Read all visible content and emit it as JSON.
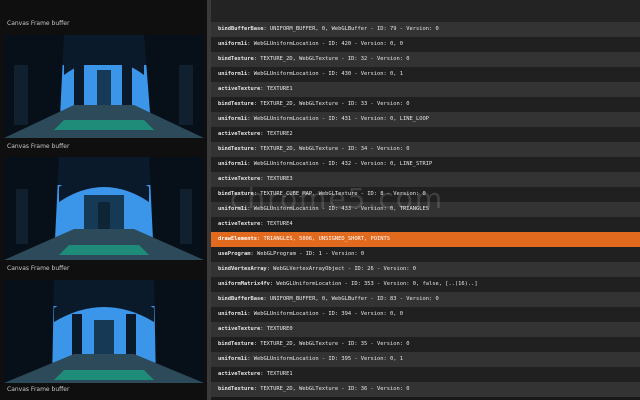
{
  "frames": [
    {
      "label": "Canvas Frame buffer"
    },
    {
      "label": "Canvas Frame buffer"
    },
    {
      "label": "Canvas Frame buffer"
    },
    {
      "label": "Canvas Frame buffer"
    }
  ],
  "commands": [
    {
      "name": "bindBufferBase",
      "args": ": UNIFORM_BUFFER, 0, WebGLBuffer - ID: 79 - Version: 0"
    },
    {
      "name": "uniform1i",
      "args": ": WebGLUniformLocation - ID: 420 - Version: 0, 0"
    },
    {
      "name": "bindTexture",
      "args": ": TEXTURE_2D, WebGLTexture - ID: 32 - Version: 0"
    },
    {
      "name": "uniform1i",
      "args": ": WebGLUniformLocation - ID: 430 - Version: 0, 1"
    },
    {
      "name": "activeTexture",
      "args": ": TEXTURE1"
    },
    {
      "name": "bindTexture",
      "args": ": TEXTURE_2D, WebGLTexture - ID: 33 - Version: 0"
    },
    {
      "name": "uniform1i",
      "args": ": WebGLUniformLocation - ID: 431 - Version: 0, LINE_LOOP"
    },
    {
      "name": "activeTexture",
      "args": ": TEXTURE2"
    },
    {
      "name": "bindTexture",
      "args": ": TEXTURE_2D, WebGLTexture - ID: 34 - Version: 0"
    },
    {
      "name": "uniform1i",
      "args": ": WebGLUniformLocation - ID: 432 - Version: 0, LINE_STRIP"
    },
    {
      "name": "activeTexture",
      "args": ": TEXTURE3"
    },
    {
      "name": "bindTexture",
      "args": ": TEXTURE_CUBE_MAP, WebGLTexture - ID: 8 - Version: 0"
    },
    {
      "name": "uniform1i",
      "args": ": WebGLUniformLocation - ID: 433 - Version: 0, TRIANGLES"
    },
    {
      "name": "activeTexture",
      "args": ": TEXTURE4"
    },
    {
      "name": "drawElements",
      "args": ": TRIANGLES, 5006, UNSIGNED_SHORT, POINTS",
      "highlight": true
    },
    {
      "name": "useProgram",
      "args": ": WebGLProgram - ID: 1 - Version: 0"
    },
    {
      "name": "bindVertexArray",
      "args": ": WebGLVertexArrayObject - ID: 26 - Version: 0"
    },
    {
      "name": "uniformMatrix4fv",
      "args": ": WebGLUniformLocation - ID: 353 - Version: 0, false, [..(16)..]"
    },
    {
      "name": "bindBufferBase",
      "args": ": UNIFORM_BUFFER, 0, WebGLBuffer - ID: 83 - Version: 0"
    },
    {
      "name": "uniform1i",
      "args": ": WebGLUniformLocation - ID: 394 - Version: 0, 0"
    },
    {
      "name": "activeTexture",
      "args": ": TEXTURE0"
    },
    {
      "name": "bindTexture",
      "args": ": TEXTURE_2D, WebGLTexture - ID: 35 - Version: 0"
    },
    {
      "name": "uniform1i",
      "args": ": WebGLUniformLocation - ID: 395 - Version: 0, 1"
    },
    {
      "name": "activeTexture",
      "args": ": TEXTURE1"
    },
    {
      "name": "bindTexture",
      "args": ": TEXTURE_2D, WebGLTexture - ID: 36 - Version: 0"
    }
  ],
  "watermark": "chrome5.com",
  "colors": {
    "highlight": "#e26a1f",
    "sky": "#3b95e8"
  }
}
